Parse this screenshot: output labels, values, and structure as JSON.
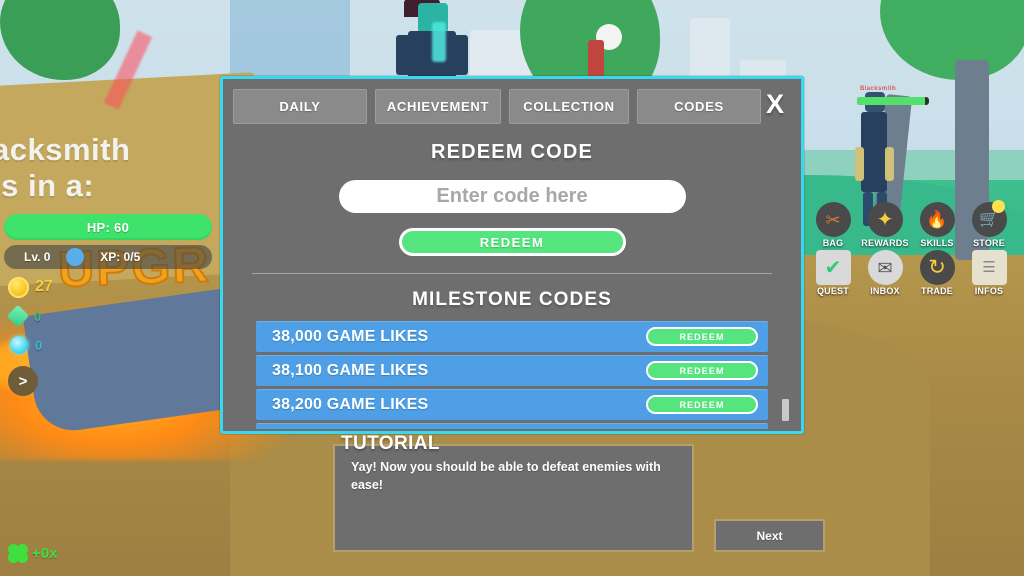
{
  "hud": {
    "hp_label": "HP: 60",
    "level_label": "Lv. 0",
    "xp_label": "XP: 0/5",
    "currencies": [
      {
        "icon": "gold-coin-icon",
        "value": "27"
      },
      {
        "icon": "green-gem-icon",
        "value": "0"
      },
      {
        "icon": "cyan-gem-icon",
        "value": "0"
      }
    ],
    "expander_label": ">",
    "boost": {
      "icon": "clover-icon",
      "label": "+0x"
    }
  },
  "scene": {
    "sign_line1": "acksmith",
    "sign_line2": "is in a:",
    "upgrade_text": "UPGR",
    "npc_name": "Blacksmith"
  },
  "icon_menu": [
    {
      "name": "bag",
      "label": "BAG",
      "glyph": "✂",
      "badge": false
    },
    {
      "name": "rewards",
      "label": "REWARDS",
      "glyph": "✦",
      "badge": false
    },
    {
      "name": "skills",
      "label": "SKILLS",
      "glyph": "🔥",
      "badge": false
    },
    {
      "name": "store",
      "label": "STORE",
      "glyph": "🛒",
      "badge": true
    },
    {
      "name": "quest",
      "label": "QUEST",
      "glyph": "✔",
      "badge": false
    },
    {
      "name": "inbox",
      "label": "INBOX",
      "glyph": "✉",
      "badge": false
    },
    {
      "name": "trade",
      "label": "TRADE",
      "glyph": "↻",
      "badge": false
    },
    {
      "name": "infos",
      "label": "INFOS",
      "glyph": "☰",
      "badge": false
    }
  ],
  "modal": {
    "close_label": "X",
    "tabs": [
      {
        "id": "daily",
        "label": "DAILY"
      },
      {
        "id": "achievement",
        "label": "ACHIEVEMENT"
      },
      {
        "id": "collection",
        "label": "COLLECTION"
      },
      {
        "id": "codes",
        "label": "CODES"
      }
    ],
    "redeem_title": "REDEEM CODE",
    "code_input": {
      "value": "",
      "placeholder": "Enter code here"
    },
    "redeem_button": "REDEEM",
    "milestone_title": "MILESTONE CODES",
    "milestones": [
      {
        "title": "38,000 GAME LIKES",
        "button": "REDEEM"
      },
      {
        "title": "38,100 GAME LIKES",
        "button": "REDEEM"
      },
      {
        "title": "38,200 GAME LIKES",
        "button": "REDEEM"
      },
      {
        "title": "",
        "button": ""
      }
    ]
  },
  "tutorial": {
    "title": "TUTORIAL",
    "text": "Yay! Now you should be able to defeat enemies with ease!",
    "next_label": "Next"
  },
  "colors": {
    "panel_border": "#3ad8f0",
    "panel_bg": "#6e6e6e",
    "accent_green": "#55e47d",
    "row_blue": "#4e9fe6",
    "coin_gold": "#f7cf3a"
  }
}
